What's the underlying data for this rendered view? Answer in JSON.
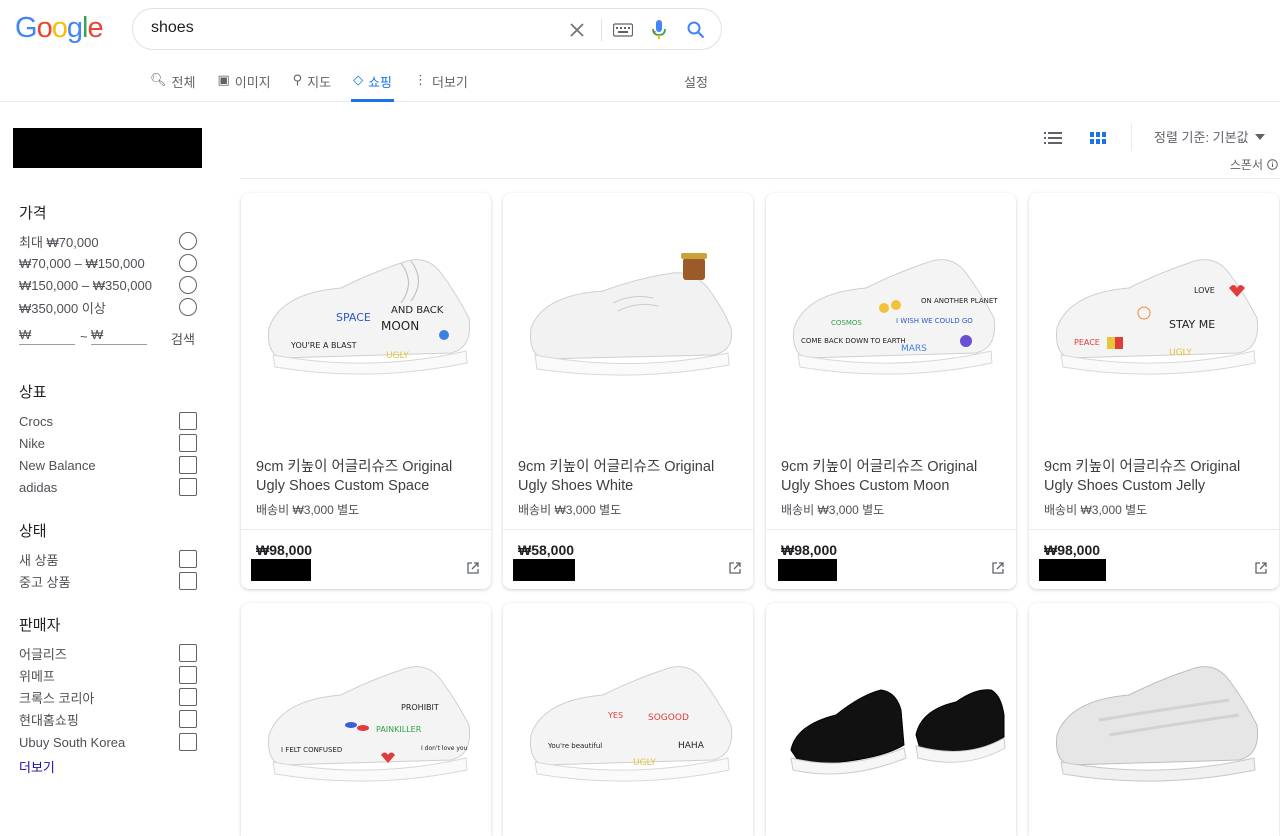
{
  "logo": [
    "G",
    "o",
    "o",
    "g",
    "l",
    "e"
  ],
  "search": {
    "value": "shoes"
  },
  "tabs": [
    {
      "icon": "search-icon",
      "label": "전체"
    },
    {
      "icon": "image-icon",
      "label": "이미지"
    },
    {
      "icon": "map-pin-icon",
      "label": "지도"
    },
    {
      "icon": "tag-icon",
      "label": "쇼핑"
    },
    {
      "icon": "more-vert-icon",
      "label": "더보기"
    }
  ],
  "settings_label": "설정",
  "sidebar": {
    "price_title": "가격",
    "price_options": [
      "최대 ₩70,000",
      "₩70,000 – ₩150,000",
      "₩150,000 – ₩350,000",
      "₩350,000 이상"
    ],
    "range_from": "₩",
    "range_sep": "~",
    "range_to": "₩",
    "range_search": "검색",
    "brand_title": "상표",
    "brands": [
      "Crocs",
      "Nike",
      "New Balance",
      "adidas"
    ],
    "condition_title": "상태",
    "conditions": [
      "새 상품",
      "중고 상품"
    ],
    "seller_title": "판매자",
    "sellers": [
      "어글리즈",
      "위메프",
      "크록스 코리아",
      "현대홈쇼핑",
      "Ubuy South Korea"
    ],
    "more_label": "더보기"
  },
  "toolbar": {
    "sort_label": "정렬 기준: 기본값",
    "sponsor_label": "스폰서"
  },
  "products": [
    {
      "title": "9cm 키높이 어글리슈즈 Original Ugly Shoes Custom Space",
      "shipping": "배송비 ₩3,000 별도",
      "price": "₩98,000"
    },
    {
      "title": "9cm 키높이 어글리슈즈 Original Ugly Shoes White",
      "shipping": "배송비 ₩3,000 별도",
      "price": "₩58,000"
    },
    {
      "title": "9cm 키높이 어글리슈즈 Original Ugly Shoes Custom Moon",
      "shipping": "배송비 ₩3,000 별도",
      "price": "₩98,000"
    },
    {
      "title": "9cm 키높이 어글리슈즈 Original Ugly Shoes Custom Jelly",
      "shipping": "배송비 ₩3,000 별도",
      "price": "₩98,000"
    }
  ],
  "colors": {
    "accent": "#1a73e8",
    "link": "#1a0dab",
    "text": "#202124",
    "muted": "#5f6368"
  }
}
